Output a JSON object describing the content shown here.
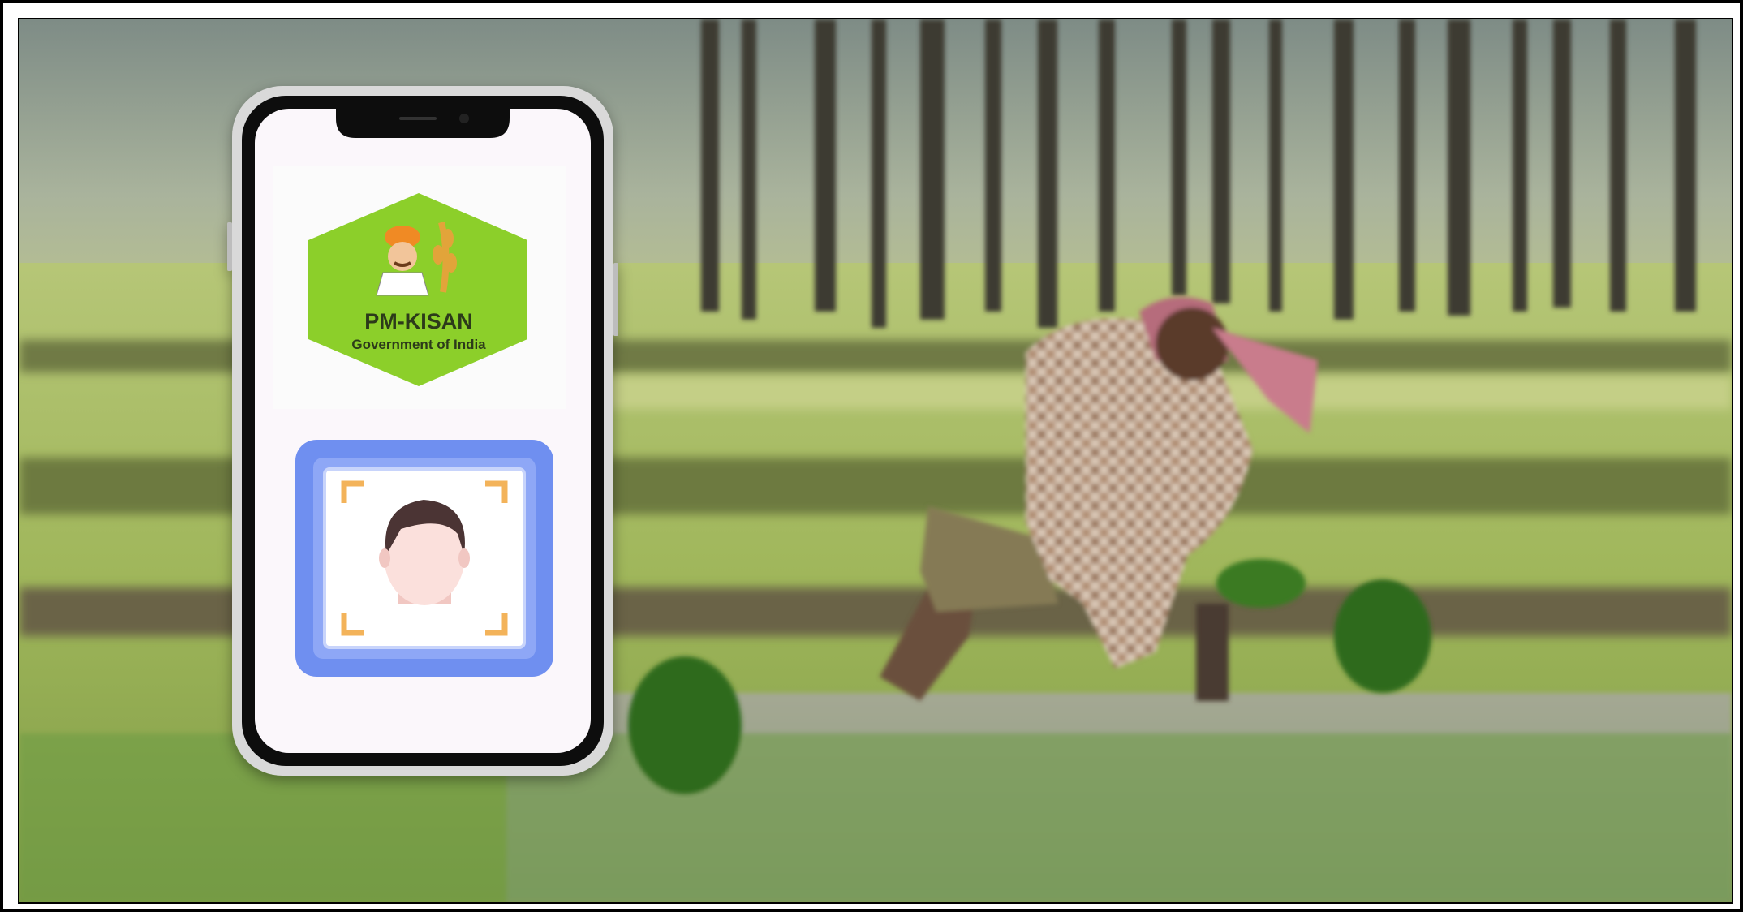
{
  "logo": {
    "title": "PM-KISAN",
    "subtitle": "Government of India",
    "accent_color": "#8ccf2a"
  },
  "icons": {
    "face_scan": "face-recognition-icon",
    "farmer_emblem": "farmer-with-wheat-icon"
  },
  "colors": {
    "phone_frame": "#d9d9d9",
    "screen_bg": "#fbf7fb",
    "face_card": "#6f8ff0",
    "scan_corners": "#f3b35a"
  }
}
